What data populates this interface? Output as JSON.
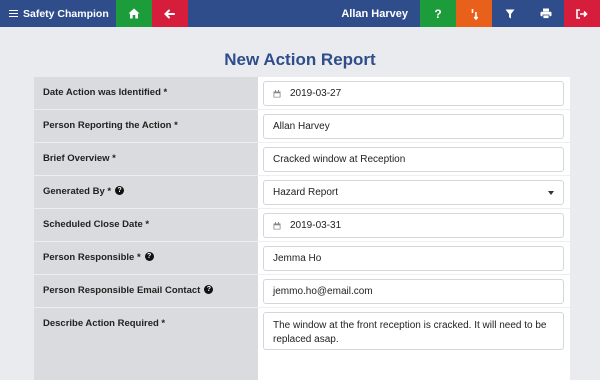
{
  "app": {
    "brand": "Safety Champion",
    "user_name": "Allan Harvey"
  },
  "toolbar": {
    "help_label": "?"
  },
  "page": {
    "title": "New Action Report"
  },
  "form": {
    "fields": [
      {
        "label": "Date Action was Identified *",
        "value": "2019-03-27"
      },
      {
        "label": "Person Reporting the Action *",
        "value": "Allan Harvey"
      },
      {
        "label": "Brief Overview *",
        "value": "Cracked window at Reception"
      },
      {
        "label": "Generated By *",
        "value": "Hazard Report"
      },
      {
        "label": "Scheduled Close Date *",
        "value": "2019-03-31"
      },
      {
        "label": "Person Responsible *",
        "value": "Jemma Ho"
      },
      {
        "label": "Person Responsible Email Contact",
        "value": "jemmo.ho@email.com"
      },
      {
        "label": "Describe Action Required *",
        "value": "The window at the front reception is cracked. It will need to be replaced asap."
      }
    ]
  },
  "colors": {
    "navbar": "#2f4d8a",
    "green": "#1c9c3b",
    "red": "#d61d3b",
    "orange": "#e8601a",
    "title": "#2f4d8a",
    "label_bg": "#d9dbde",
    "page_bg": "#e9ebef"
  }
}
